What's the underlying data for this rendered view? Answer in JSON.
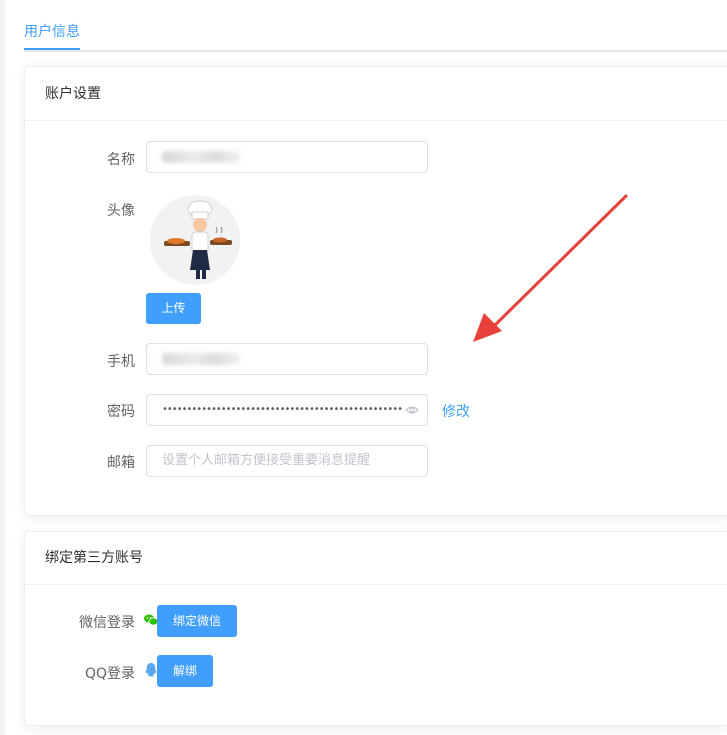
{
  "tabs": {
    "active": "用户信息"
  },
  "account": {
    "title": "账户设置",
    "name_label": "名称",
    "avatar_label": "头像",
    "upload_button": "上传",
    "phone_label": "手机",
    "password_label": "密码",
    "password_dots": "•••••••••••••••••••••••••••••••••••••••••••••••••",
    "modify_link": "修改",
    "email_label": "邮箱",
    "email_placeholder": "设置个人邮箱方便接受重要消息提醒"
  },
  "third_party": {
    "title": "绑定第三方账号",
    "wechat_label": "微信登录",
    "wechat_button": "绑定微信",
    "qq_label": "QQ登录",
    "qq_button": "解绑"
  },
  "colors": {
    "primary": "#409eff",
    "arrow": "#e8403a",
    "wechat": "#2dc100",
    "qq": "#1e9bf0"
  }
}
